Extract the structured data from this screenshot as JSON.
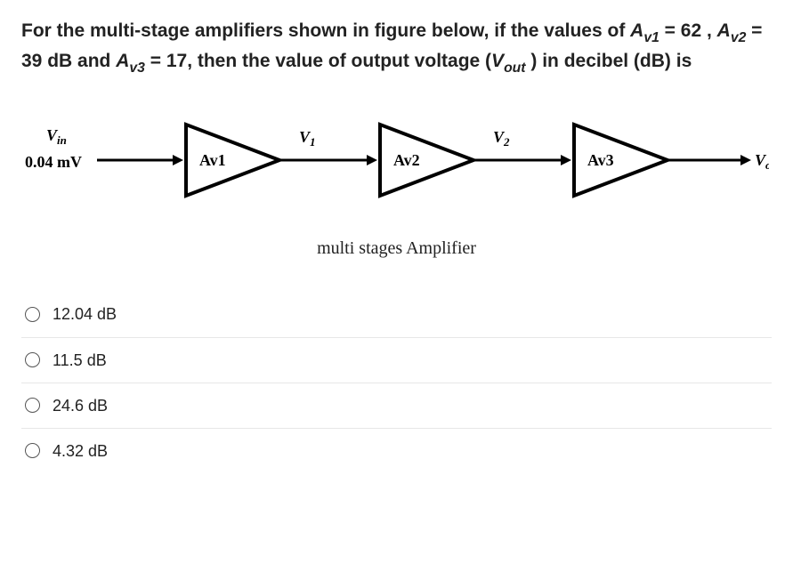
{
  "question": {
    "prefix": "For the multi-stage amplifiers shown in figure below, if the values of ",
    "av1_sym": "A",
    "av1_sub": "v1",
    "av1_eq": " = 62  , ",
    "av2_sym": "A",
    "av2_sub": "v2",
    "av2_eq": " = 39 dB  and ",
    "av3_sym": "A",
    "av3_sub": "v3",
    "av3_eq": " = 17,  then the value of output voltage (",
    "vout_sym": "V",
    "vout_sub": "out",
    "suffix": " ) in decibel (dB) is"
  },
  "diagram": {
    "vin_label": "V",
    "vin_sub": "in",
    "vin_value": "0.04 mV",
    "stage1": "Av1",
    "v1_label": "V",
    "v1_sub": "1",
    "stage2": "Av2",
    "v2_label": "V",
    "v2_sub": "2",
    "stage3": "Av3",
    "vout_label": "V",
    "vout_sub": "out",
    "caption": "multi stages Amplifier"
  },
  "options": [
    "12.04 dB",
    "11.5 dB",
    "24.6 dB",
    "4.32 dB"
  ]
}
